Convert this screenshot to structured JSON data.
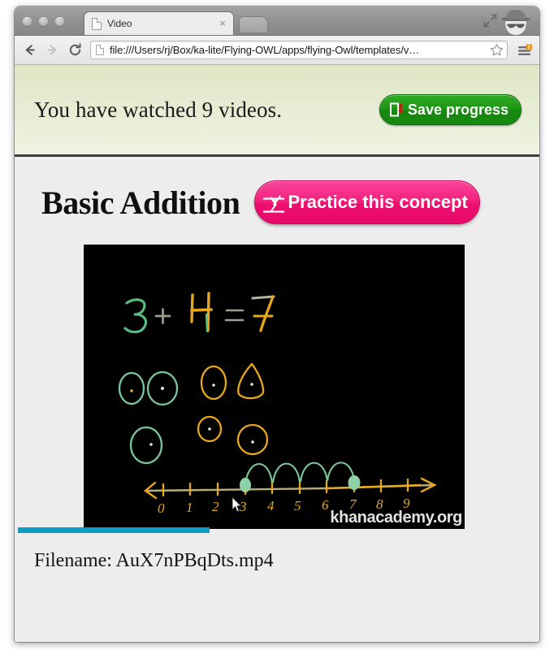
{
  "browser": {
    "tab": {
      "title": "Video",
      "favicon": "page-icon",
      "close_label": "×"
    },
    "toolbar": {
      "back_icon": "back-arrow-icon",
      "forward_icon": "forward-arrow-icon",
      "reload_icon": "reload-icon",
      "bookmark_icon": "star-icon",
      "menu_icon": "hamburger-menu-icon",
      "url": "file:///Users/rj/Box/ka-lite/Flying-OWL/apps/flying-Owl/templates/v…"
    },
    "window_controls": {
      "maximize_icon": "maximize-icon",
      "profile_icon": "incognito-icon",
      "dots": [
        "dot-1",
        "dot-2",
        "dot-3"
      ]
    }
  },
  "banner": {
    "watched_text": "You have watched 9 videos.",
    "videos_watched": 9,
    "save_button": {
      "label": "Save progress",
      "icon": "save-download-icon",
      "color": "#1d9614"
    },
    "background_color": "#e6ecd2"
  },
  "page": {
    "title": "Basic Addition",
    "practice_button": {
      "label": "Practice this concept",
      "icon": "gymnast-icon",
      "color": "#ec0f6f"
    },
    "filename_label": "Filename: AuX7nPBqDts.mp4",
    "filename_value": "AuX7nPBqDts.mp4"
  },
  "video": {
    "watermark": "khanacademy.org",
    "progress_percent": 38,
    "progress_color": "#0d9dc4",
    "frame": {
      "equation": "3 + 4 = 7",
      "addend_1": "3",
      "addend_2": "4",
      "sum": "7",
      "number_line_labels": [
        "0",
        "1",
        "2",
        "3",
        "4",
        "5",
        "6",
        "7",
        "8",
        "9"
      ],
      "hop_start": 3,
      "hop_end": 7,
      "green_circle_count": 3,
      "orange_circle_count": 4
    }
  }
}
